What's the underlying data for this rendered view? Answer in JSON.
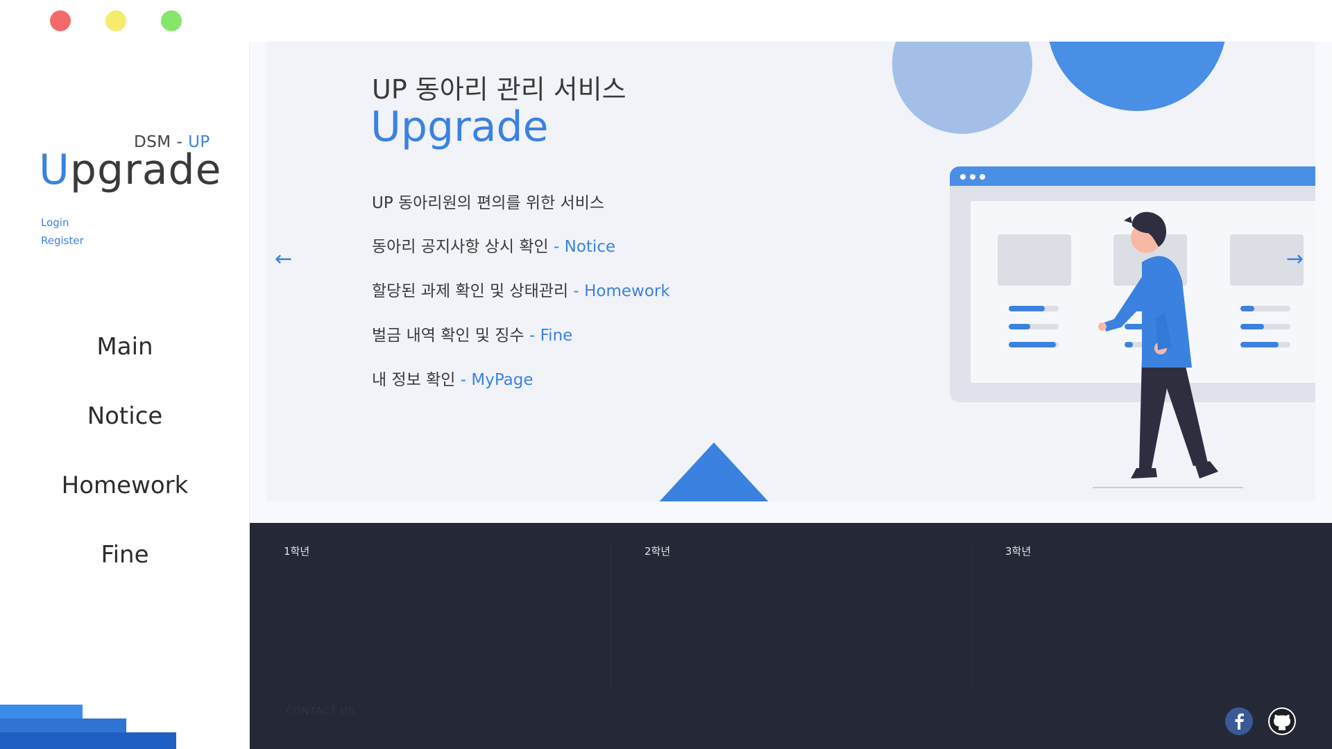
{
  "brand": {
    "sub_prefix": "DSM - ",
    "sub_accent": "UP",
    "first_letter": "U",
    "rest": "pgrade"
  },
  "auth": {
    "login": "Login",
    "register": "Register"
  },
  "nav": [
    "Main",
    "Notice",
    "Homework",
    "Fine"
  ],
  "hero": {
    "title": "UP 동아리 관리 서비스",
    "big": "Upgrade",
    "features": [
      {
        "text": "UP 동아리원의 편의를 위한 서비스",
        "sep": "",
        "link": ""
      },
      {
        "text": "동아리 공지사항 상시 확인 ",
        "sep": "- ",
        "link": "Notice"
      },
      {
        "text": "할당된 과제 확인 및 상태관리 ",
        "sep": "- ",
        "link": "Homework"
      },
      {
        "text": "벌금 내역 확인 및 징수 ",
        "sep": "- ",
        "link": "Fine"
      },
      {
        "text": "내 정보 확인 ",
        "sep": "- ",
        "link": "MyPage"
      }
    ],
    "prev_arrow": "←",
    "next_arrow": "→"
  },
  "footer": {
    "grades": [
      "1학년",
      "2학년",
      "3학년"
    ],
    "contact": "CONTACT US"
  },
  "colors": {
    "accent": "#3b82e0",
    "dot_close": "#f46a6a",
    "dot_min": "#f5ec6e",
    "dot_max": "#86e56b",
    "footer_bg": "#252837",
    "facebook": "#3b5998"
  },
  "icons": {
    "facebook": "facebook-icon",
    "github": "github-icon"
  }
}
